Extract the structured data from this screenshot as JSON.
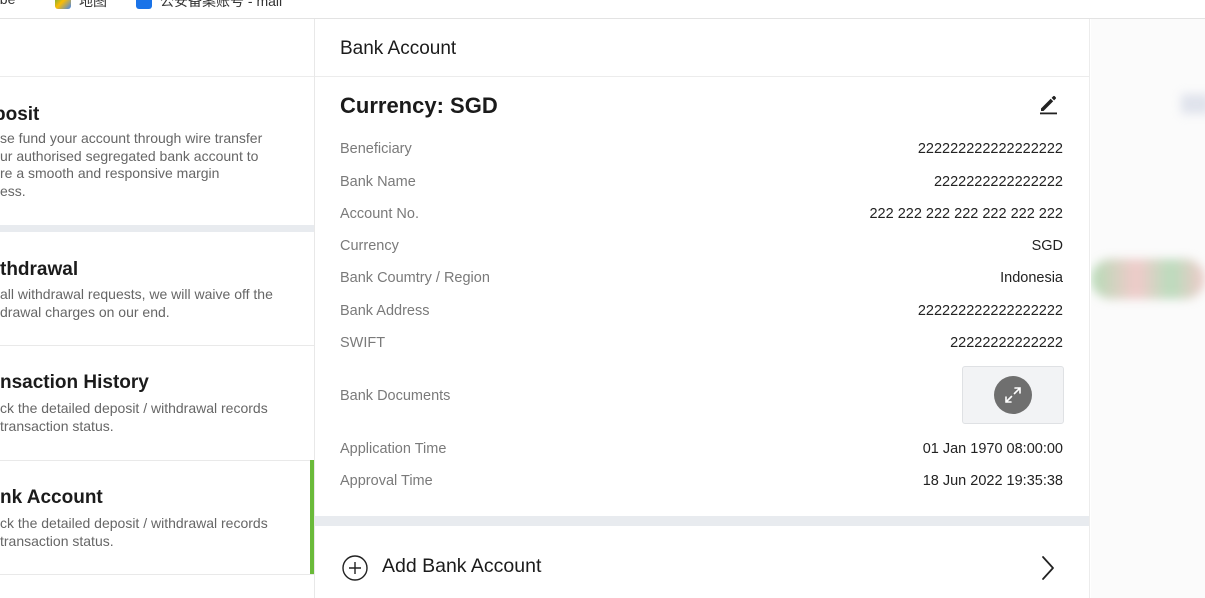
{
  "bookmarks": [
    {
      "label": "ube",
      "icon": "youtube-icon",
      "color": "#cc0000"
    },
    {
      "label": "地图",
      "icon": "maps-icon",
      "color": "#34a853"
    },
    {
      "label": "公安备案账号 - mail",
      "icon": "mail-icon",
      "color": "#1a73e8"
    }
  ],
  "sidebar": {
    "cards": [
      {
        "title": "posit",
        "desc": "se fund your account through wire transfer\nur authorised segregated bank account to\nre a smooth and responsive margin\ness."
      },
      {
        "title": "thdrawal",
        "desc": "all withdrawal requests, we will waive off the\ndrawal charges on our end."
      },
      {
        "title": "nsaction History",
        "desc": "ck the detailed deposit / withdrawal records\ntransaction status."
      },
      {
        "title": "nk Account",
        "desc": "ck the detailed deposit / withdrawal records\ntransaction status."
      }
    ],
    "active_color": "#6aba39"
  },
  "main": {
    "title": "Bank Account",
    "currency_heading": "Currency: SGD",
    "rows": [
      {
        "label": "Beneficiary",
        "value": "222222222222222222"
      },
      {
        "label": "Bank Name",
        "value": "2222222222222222"
      },
      {
        "label": "Account No.",
        "value": "222 222 222 222 222 222 222"
      },
      {
        "label": "Currency",
        "value": "SGD"
      },
      {
        "label": "Bank Coumtry / Region",
        "value": "Indonesia"
      },
      {
        "label": "Bank Address",
        "value": "222222222222222222"
      },
      {
        "label": "SWIFT",
        "value": "22222222222222"
      }
    ],
    "documents_label": "Bank Documents",
    "time_rows": [
      {
        "label": "Application Time",
        "value": "01 Jan 1970 08:00:00"
      },
      {
        "label": "Approval Time",
        "value": "18 Jun 2022 19:35:38"
      }
    ],
    "add_label": "Add Bank Account"
  }
}
